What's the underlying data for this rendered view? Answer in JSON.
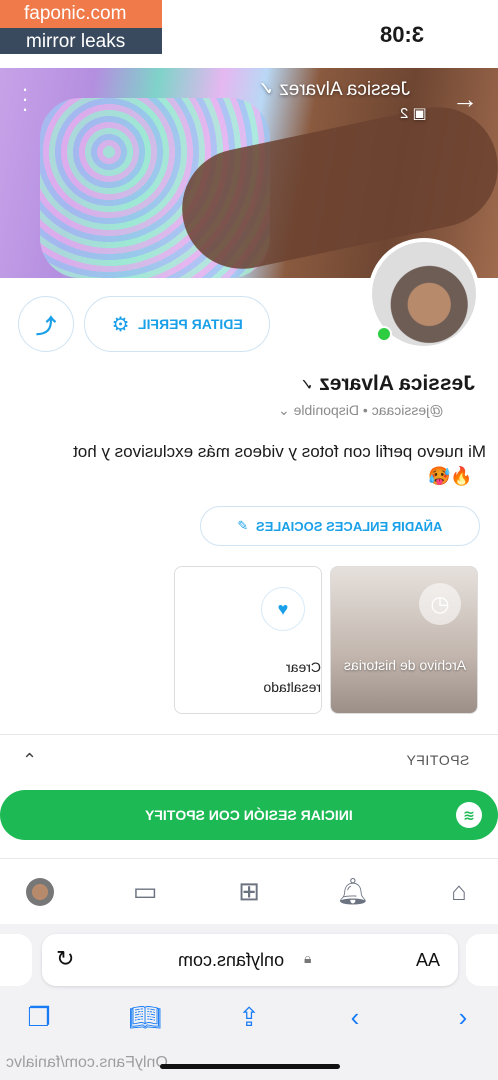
{
  "status_bar": {
    "time": "3:08"
  },
  "watermark": {
    "line1": "faponic.com",
    "line2": "mirror leaks",
    "bottom": "OnlyFans.com/fanialvc"
  },
  "cover": {
    "title": "Jessica Alvarez",
    "media_count": "2",
    "icons": [
      "arrow-right-icon",
      "more-vertical-icon",
      "image-icon",
      "verified-icon"
    ]
  },
  "profile": {
    "name": "Jessica Alvarez",
    "handle": "@jessicaac",
    "status": "Disponible",
    "bio": "Mi nuevo perfil con fotos y videos más exclusivos y hot",
    "bio_emoji": "🥵🔥",
    "online": true
  },
  "actions": {
    "edit_profile": "EDITAR PERFIL",
    "add_social": "AÑADIR ENLACES SOCIALES"
  },
  "highlights": [
    {
      "label": "Archivo de historias"
    },
    {
      "label": "Crear resaltado"
    }
  ],
  "spotify": {
    "section_title": "SPOTIFY",
    "login_button": "INICIAR SESIÓN CON SPOTIFY"
  },
  "bottom_nav": [
    "home-icon",
    "bell-icon",
    "plus-square-icon",
    "message-icon",
    "avatar"
  ],
  "browser": {
    "url": "onlyfans.com",
    "aa": "AA"
  },
  "colors": {
    "accent": "#1aa0e8",
    "spotify": "#1db954",
    "online": "#2ecc40",
    "safari_blue": "#1a7cf5"
  }
}
